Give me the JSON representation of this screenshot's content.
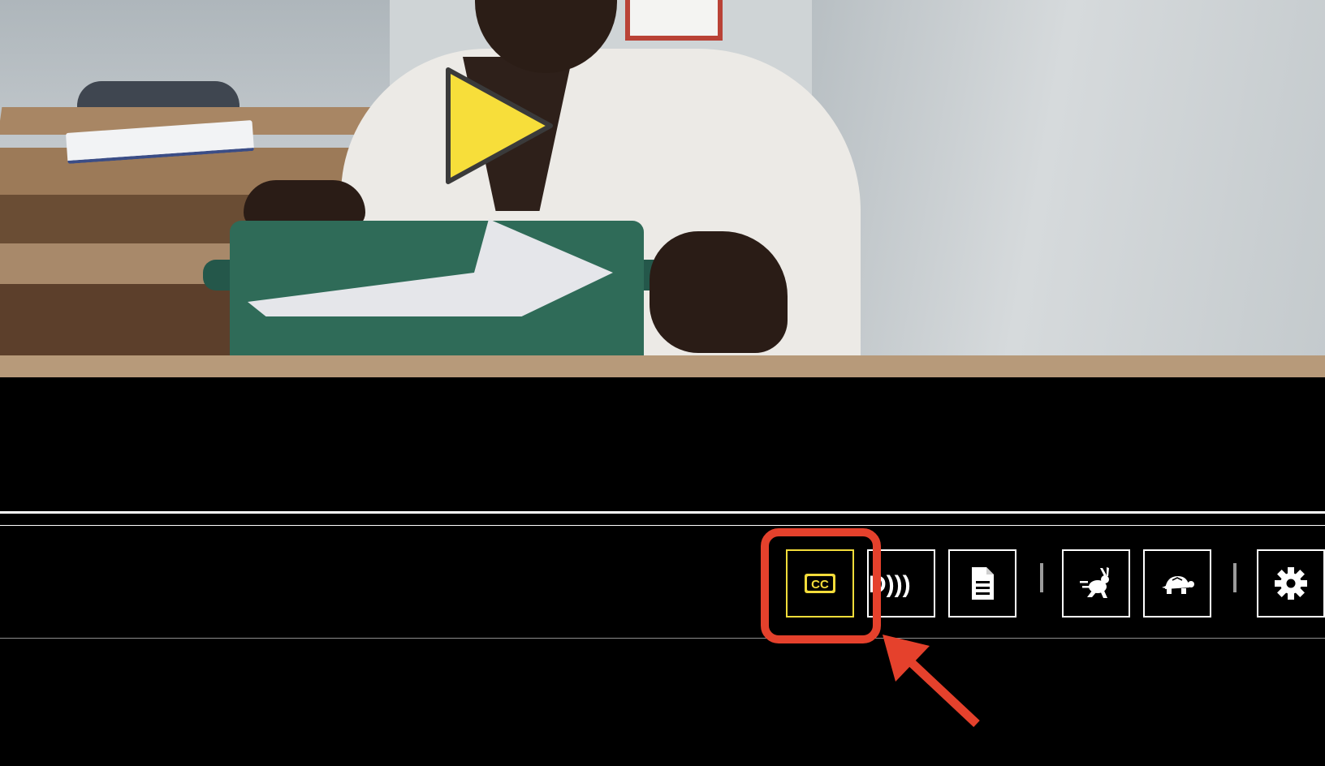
{
  "video": {
    "description": "",
    "play_button": {
      "icon": "play-icon",
      "color": "#f7de3a"
    }
  },
  "controls": {
    "buttons": [
      {
        "id": "captions",
        "icon": "cc-icon",
        "label": "CC",
        "active": true
      },
      {
        "id": "audio-description",
        "icon": "audio-description-icon",
        "label": "D)))"
      },
      {
        "id": "transcript",
        "icon": "transcript-icon"
      },
      {
        "id": "faster",
        "icon": "rabbit-icon"
      },
      {
        "id": "slower",
        "icon": "turtle-icon"
      },
      {
        "id": "preferences",
        "icon": "gear-icon"
      }
    ],
    "accent_color": "#f3dc3a"
  },
  "annotation": {
    "color": "#e5412c",
    "target": "captions"
  }
}
